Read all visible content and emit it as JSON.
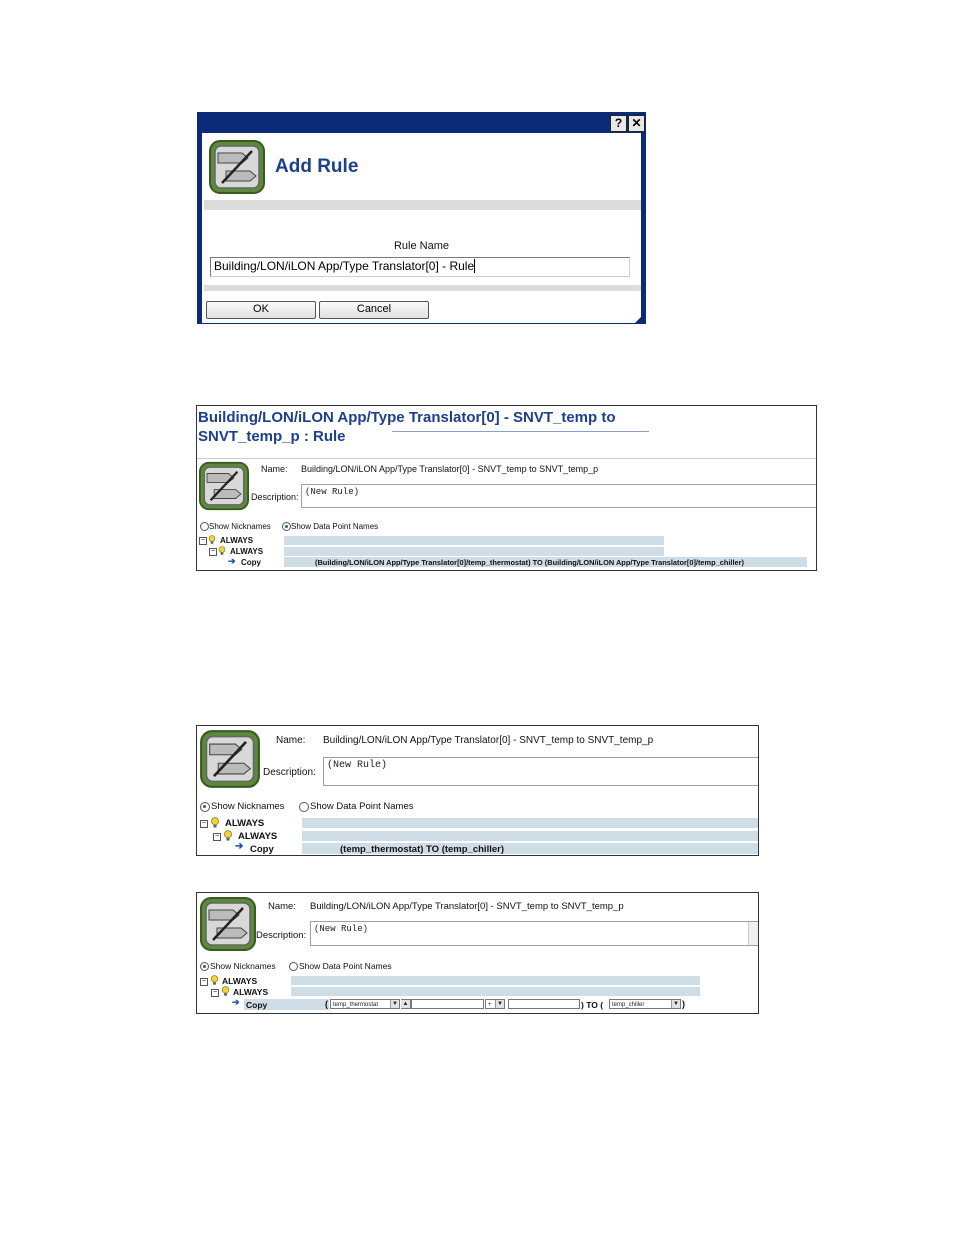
{
  "dialog": {
    "help_button": "?",
    "close_button": "✕",
    "title": "Add Rule",
    "rule_name_label": "Rule Name",
    "rule_name_value": "Building/LON/iLON App/Type Translator[0] - Rule",
    "ok_label": "OK",
    "cancel_label": "Cancel"
  },
  "panel1": {
    "title_line1": "Building/LON/iLON App/Type Translator[0] - SNVT_temp to",
    "title_line2": "SNVT_temp_p : Rule",
    "name_label": "Name:",
    "name_value": "Building/LON/iLON App/Type Translator[0] - SNVT_temp to SNVT_temp_p",
    "description_label": "Description:",
    "description_value": "(New Rule)",
    "show_nicknames": "Show Nicknames",
    "show_datapoint_names": "Show Data Point Names",
    "always1": "ALWAYS",
    "always2": "ALWAYS",
    "copy": "Copy",
    "copy_expression": "(Building/LON/iLON App/Type Translator[0]/temp_thermostat) TO (Building/LON/iLON App/Type Translator[0]/temp_chiller)"
  },
  "panel2": {
    "name_label": "Name:",
    "name_value": "Building/LON/iLON App/Type Translator[0] - SNVT_temp to SNVT_temp_p",
    "description_label": "Description:",
    "description_value": "(New Rule)",
    "show_nicknames": "Show Nicknames",
    "show_datapoint_names": "Show Data Point Names",
    "always1": "ALWAYS",
    "always2": "ALWAYS",
    "copy": "Copy",
    "copy_expression": "(temp_thermostat) TO (temp_chiller)"
  },
  "panel3": {
    "name_label": "Name:",
    "name_value": "Building/LON/iLON App/Type Translator[0] - SNVT_temp to SNVT_temp_p",
    "description_label": "Description:",
    "description_value": "(New Rule)",
    "show_nicknames": "Show Nicknames",
    "show_datapoint_names": "Show Data Point Names",
    "always1": "ALWAYS",
    "always2": "ALWAYS",
    "copy": "Copy",
    "open_paren": "(",
    "source_select": "temp_thermostat",
    "operator_select": "+",
    "close_to": ") TO (",
    "target_select": "temp_chiller",
    "close_paren": ")"
  },
  "icons": {
    "rule": "rule-icon",
    "bulb": "lightbulb-icon",
    "arrow": "arrow-right-icon"
  },
  "colors": {
    "title_blue": "#1d3f8f",
    "dialog_frame": "#0b2a78",
    "row_highlight": "#cfdde6"
  }
}
